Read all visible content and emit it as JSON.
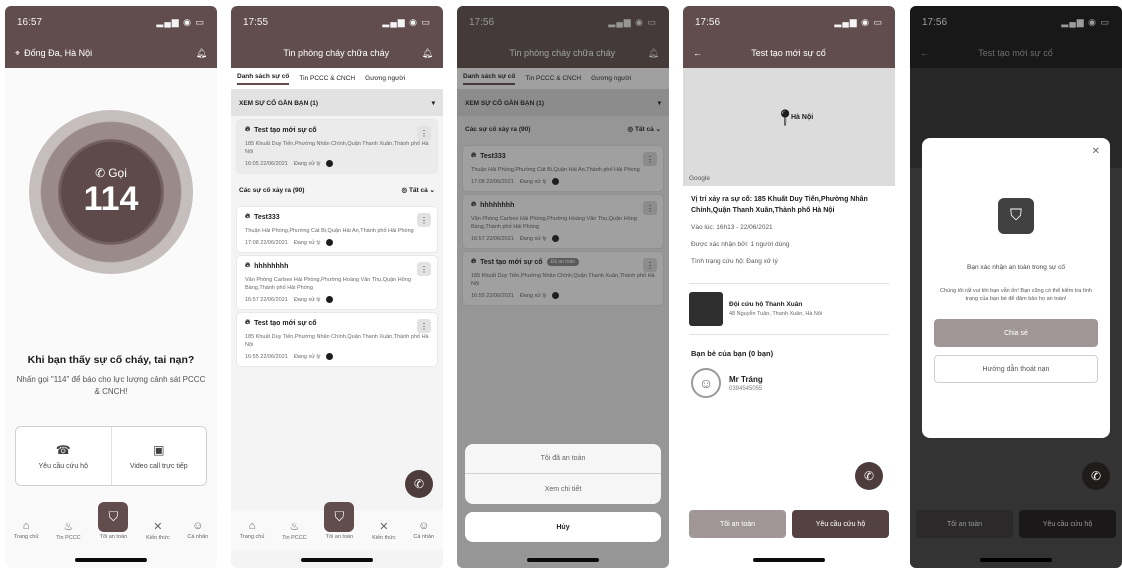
{
  "phone1": {
    "time": "16:57",
    "location": "Đống Đa, Hà Nội",
    "call_label": "Gọi",
    "call_number": "114",
    "headline": "Khi bạn thấy sự cố cháy, tai nạn?",
    "subtext": "Nhấn gọi \"114\" để báo cho lực lượng cảnh sát PCCC & CNCH!",
    "action_rescue": "Yêu cầu cứu hộ",
    "action_video": "Video call trực tiếp",
    "tabs": [
      "Trang chủ",
      "Tin PCCC",
      "Tôi an toàn",
      "Kiến thức",
      "Cá nhân"
    ]
  },
  "phone2": {
    "time": "17:55",
    "header": "Tin phòng cháy chữa cháy",
    "tabs": [
      "Danh sách sự cố",
      "Tin PCCC & CNCH",
      "Gương người"
    ],
    "nearby": "XEM SỰ CỐ GẦN BẠN (1)",
    "incident_count": "Các sự cố xảy ra (90)",
    "filter": "Tất cả",
    "cards": [
      {
        "title": "Test tạo mới sự cố",
        "addr": "185 Khuất Duy Tiến,Phường Nhân Chính,Quận Thanh Xuân,Thành phố Hà Nội",
        "time": "16:05 22/06/2021",
        "status": "Đang xử lý"
      },
      {
        "title": "Test333",
        "addr": "Thuận Hải Phòng,Phường Cát Bi,Quận Hải An,Thành phố Hải Phòng",
        "time": "17:08 22/06/2021",
        "status": "Đang xử lý"
      },
      {
        "title": "hhhhhhhh",
        "addr": "Văn Phòng Carlsex Hải Phòng,Phường Hoàng Văn Thụ,Quận Hồng Bàng,Thành phố Hải Phòng",
        "time": "16:57 22/06/2021",
        "status": "Đang xử lý"
      },
      {
        "title": "Test tạo mới sự cố",
        "addr": "185 Khuất Duy Tiến,Phường Nhân Chính,Quận Thanh Xuân,Thành phố Hà Nội",
        "time": "16:55 22/06/2021",
        "status": "Đang xử lý"
      }
    ]
  },
  "phone3": {
    "time": "17:56",
    "header": "Tin phòng cháy chữa cháy",
    "tabs": [
      "Danh sách sự cố",
      "Tin PCCC & CNCH",
      "Gương người"
    ],
    "nearby": "XEM SỰ CỐ GẦN BẠN (1)",
    "incident_count": "Các sự cố xảy ra (90)",
    "filter": "Tất cả",
    "cards": [
      {
        "title": "Test333",
        "addr": "Thuận Hải Phòng,Phường Cát Bi,Quận Hải An,Thành phố Hải Phòng",
        "time": "17:08 22/06/2021",
        "status": "Đang xử lý"
      },
      {
        "title": "hhhhhhhh",
        "addr": "Văn Phòng Carlsex Hải Phòng,Phường Hoàng Văn Thụ,Quận Hồng Bàng,Thành phố Hải Phòng",
        "time": "16:57 22/06/2021",
        "status": "Đang xử lý"
      },
      {
        "title": "Test tạo mới sự cố",
        "badge": "Đã an toàn",
        "addr": "185 Khuất Duy Tiến,Phường Nhân Chính,Quận Thanh Xuân,Thành phố Hà Nội",
        "time": "16:55 22/06/2021",
        "status": "Đang xử lý"
      }
    ],
    "sheet_safe": "Tôi đã an toàn",
    "sheet_detail": "Xem chi tiết",
    "sheet_cancel": "Hủy"
  },
  "phone4": {
    "time": "17:56",
    "header": "Test tạo mới sự cố",
    "map_city": "Hà Nội",
    "google": "Google",
    "location": "Vị trí xảy ra sự cố: 185 Khuất Duy Tiến,Phường Nhân Chính,Quận Thanh Xuân,Thành phố Hà Nội",
    "time_row": "Vào lúc: 16h13 - 22/06/2021",
    "confirmed": "Được xác nhận bởi: 1 người dùng",
    "rescue_status": "Tình trạng cứu hộ: Đang xử lý",
    "team_name": "Đội cứu hộ Thanh Xuân",
    "team_addr": "48 Nguyễn Tuân, Thanh Xuân, Hà Nội",
    "friends_title": "Bạn bè của bạn (0 bạn)",
    "friend_name": "Mr Tráng",
    "friend_phone": "0394545055",
    "btn_safe": "Tôi an toàn",
    "btn_rescue": "Yêu cầu cứu hộ"
  },
  "phone5": {
    "time": "17:56",
    "header": "Test tạo mới sự cố",
    "modal_title": "Bạn xác nhận an toàn trong sự cố",
    "modal_desc": "Chúng tôi rất vui khi bạn vẫn ổn! Bạn cũng có thể kiểm tra tình trạng của bạn bè để đảm bảo họ an toàn!",
    "btn_confirm": "Chia sẻ",
    "btn_guide": "Hướng dẫn thoát nạn",
    "btn_safe": "Tôi an toàn",
    "btn_rescue": "Yêu cầu cứu hộ"
  }
}
